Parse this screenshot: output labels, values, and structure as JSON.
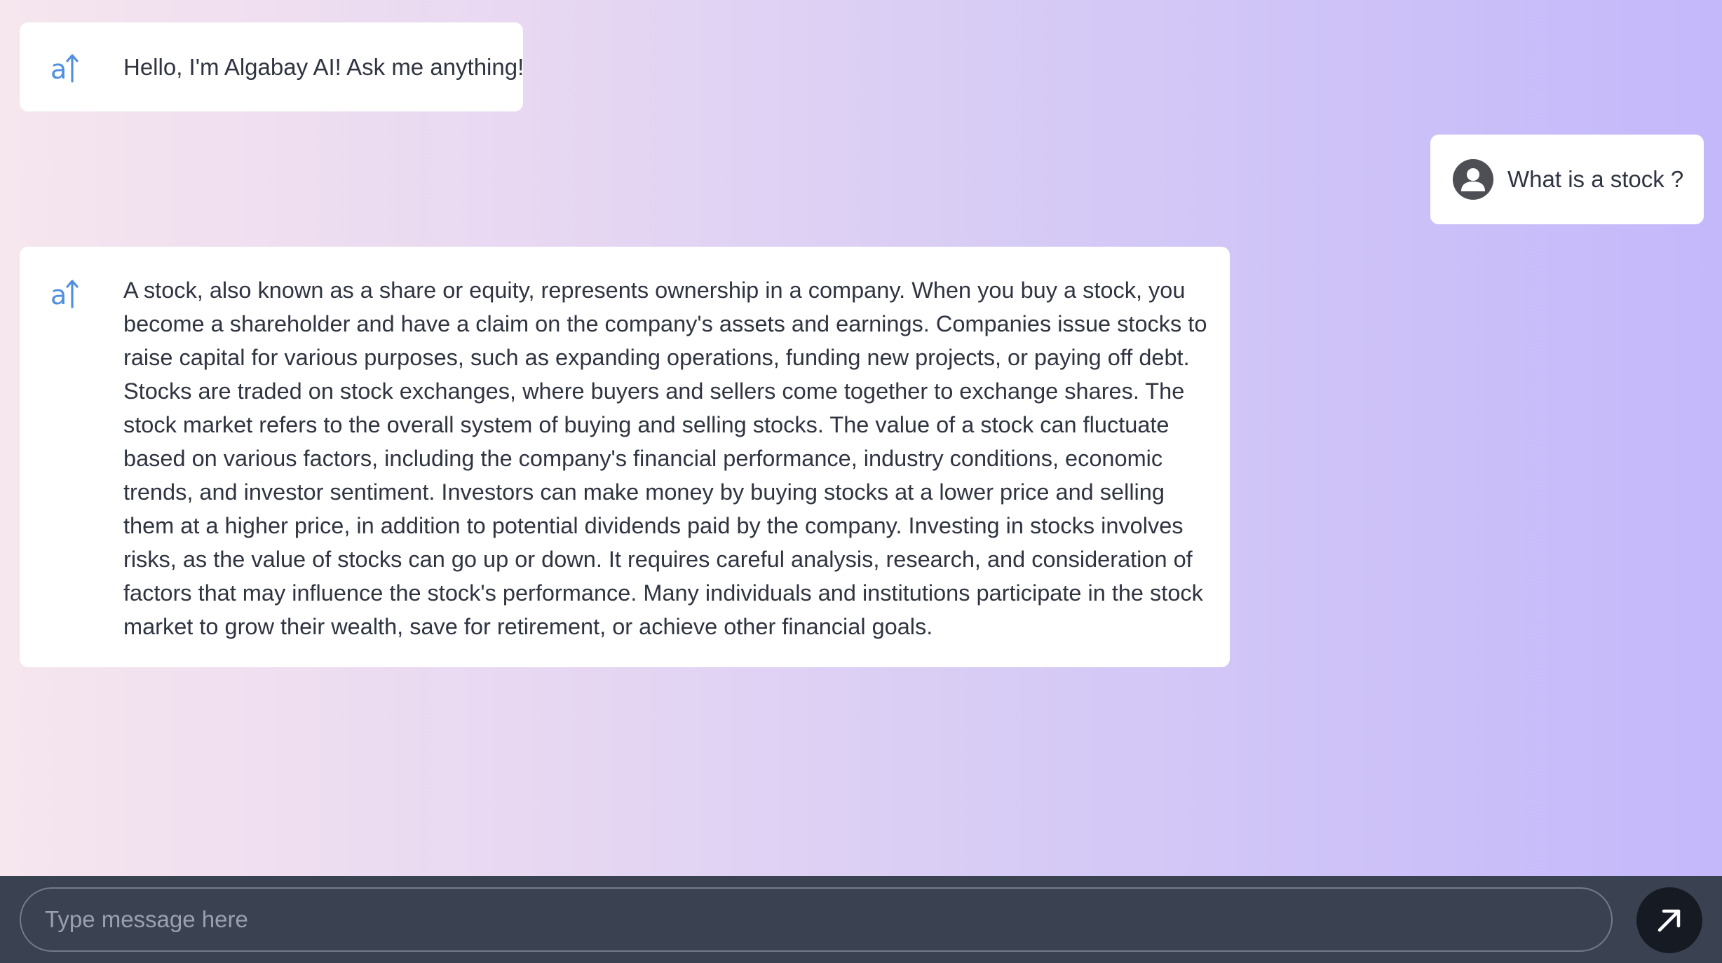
{
  "colors": {
    "bubble_bg": "#ffffff",
    "ai_icon": "#4f8fe0",
    "text": "#2f3441",
    "footer_bg": "#3a4150",
    "send_button_bg": "#161a22"
  },
  "messages": [
    {
      "sender": "ai",
      "icon": "algabay-ai-icon",
      "text": "Hello, I'm Algabay AI! Ask me anything!"
    },
    {
      "sender": "user",
      "icon": "user-avatar-icon",
      "text": "What is a stock ?"
    },
    {
      "sender": "ai",
      "icon": "algabay-ai-icon",
      "text": "A stock, also known as a share or equity, represents ownership in a company. When you buy a stock, you become a shareholder and have a claim on the company's assets and earnings. Companies issue stocks to raise capital for various purposes, such as expanding operations, funding new projects, or paying off debt. Stocks are traded on stock exchanges, where buyers and sellers come together to exchange shares. The stock market refers to the overall system of buying and selling stocks. The value of a stock can fluctuate based on various factors, including the company's financial performance, industry conditions, economic trends, and investor sentiment. Investors can make money by buying stocks at a lower price and selling them at a higher price, in addition to potential dividends paid by the company. Investing in stocks involves risks, as the value of stocks can go up or down. It requires careful analysis, research, and consideration of factors that may influence the stock's performance. Many individuals and institutions participate in the stock market to grow their wealth, save for retirement, or achieve other financial goals."
    }
  ],
  "composer": {
    "value": "",
    "placeholder": "Type message here",
    "send_icon": "arrow-up-right-icon"
  }
}
